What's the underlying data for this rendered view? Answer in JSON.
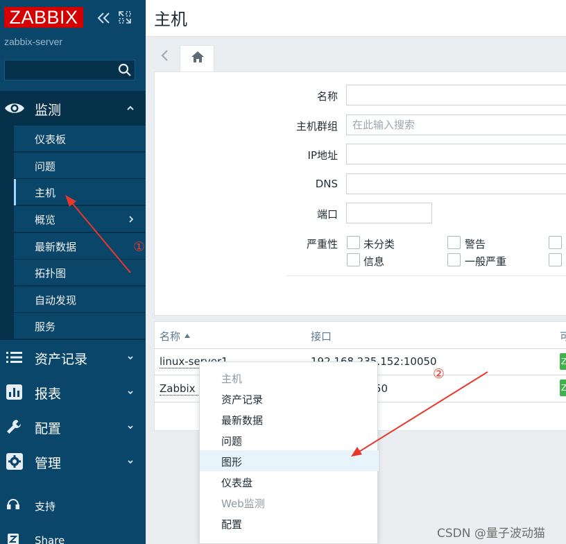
{
  "brand": {
    "logo_text": "ZABBIX",
    "server_name": "zabbix-server",
    "logo_color": "#d40000"
  },
  "sidebar": {
    "search": {
      "placeholder": "",
      "value": ""
    },
    "monitor": {
      "label": "监测",
      "icon": "eye-icon"
    },
    "submenu": [
      {
        "label": "仪表板"
      },
      {
        "label": "问题"
      },
      {
        "label": "主机",
        "active": true
      },
      {
        "label": "概览",
        "has_children": true
      },
      {
        "label": "最新数据"
      },
      {
        "label": "拓扑图"
      },
      {
        "label": "自动发现"
      },
      {
        "label": "服务"
      }
    ],
    "sections": [
      {
        "label": "资产记录",
        "icon": "list-icon"
      },
      {
        "label": "报表",
        "icon": "bar-chart-icon"
      },
      {
        "label": "配置",
        "icon": "wrench-icon"
      },
      {
        "label": "管理",
        "icon": "gear-icon"
      }
    ],
    "footer": [
      {
        "label": "支持",
        "icon": "headset-icon"
      },
      {
        "label": "Share",
        "icon": "share-icon"
      }
    ]
  },
  "page": {
    "title": "主机"
  },
  "filter": {
    "name_label": "名称",
    "hostgroup_label": "主机群组",
    "hostgroup_placeholder": "在此输入搜索",
    "ip_label": "IP地址",
    "dns_label": "DNS",
    "port_label": "端口",
    "severity_label": "严重性",
    "severities": [
      "未分类",
      "警告",
      "信息",
      "一般严重"
    ]
  },
  "table": {
    "headers": {
      "name": "名称",
      "interface": "接口",
      "availability": "可"
    },
    "rows": [
      {
        "name": "linux-server1",
        "interface": "192.168.235.152:10050",
        "badge": "Z"
      },
      {
        "name": "Zabbix s",
        "interface": "50",
        "badge": "Z"
      }
    ]
  },
  "context_menu": {
    "items": [
      {
        "label": "主机",
        "type": "header"
      },
      {
        "label": "资产记录"
      },
      {
        "label": "最新数据"
      },
      {
        "label": "问题"
      },
      {
        "label": "图形",
        "hover": true
      },
      {
        "label": "仪表盘"
      },
      {
        "label": "Web监测",
        "type": "disabled"
      },
      {
        "label": "配置"
      }
    ]
  },
  "annotations": {
    "first": "①",
    "second": "②"
  },
  "watermark": "CSDN @量子波动猫",
  "colors": {
    "sidebar_bg": "#0a466a",
    "sidebar_dark": "#06314b",
    "accent_green": "#3cb44b",
    "annotation_red": "#e8372b"
  }
}
